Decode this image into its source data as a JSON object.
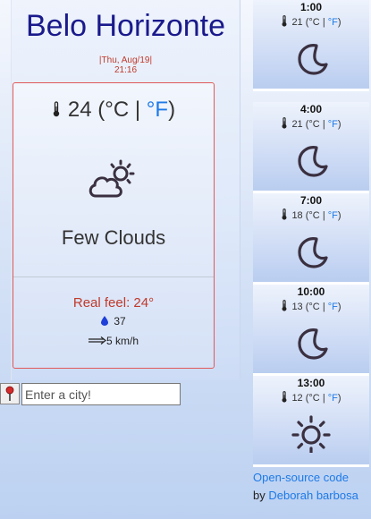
{
  "current": {
    "city": "Belo Horizonte",
    "date": "|Thu, Aug/19|",
    "time": "21:16",
    "temp": "24",
    "unit_c": "(°C",
    "unit_sep": " | ",
    "unit_f": "°F",
    "unit_close": ")",
    "condition": "Few Clouds",
    "condition_icon": "few-clouds-icon",
    "real_feel": "Real feel: 24°",
    "humidity": "37",
    "wind": "5 km/h"
  },
  "search": {
    "placeholder": "Enter a city!"
  },
  "forecast": [
    {
      "time": "1:00",
      "temp": "21",
      "icon": "moon-icon"
    },
    {
      "time": "4:00",
      "temp": "21",
      "icon": "moon-icon"
    },
    {
      "time": "7:00",
      "temp": "18",
      "icon": "moon-icon"
    },
    {
      "time": "10:00",
      "temp": "13",
      "icon": "moon-icon"
    },
    {
      "time": "13:00",
      "temp": "12",
      "icon": "sun-icon"
    }
  ],
  "forecast_units": {
    "c": "(°C",
    "sep": " | ",
    "f": "°F",
    "close": ")"
  },
  "footer": {
    "link_text": "Open-source code",
    "by": "by ",
    "author": "Deborah barbosa"
  },
  "colors": {
    "city": "#1a1a8c",
    "accent_red": "#c0392b",
    "link_blue": "#1e7ae8"
  }
}
